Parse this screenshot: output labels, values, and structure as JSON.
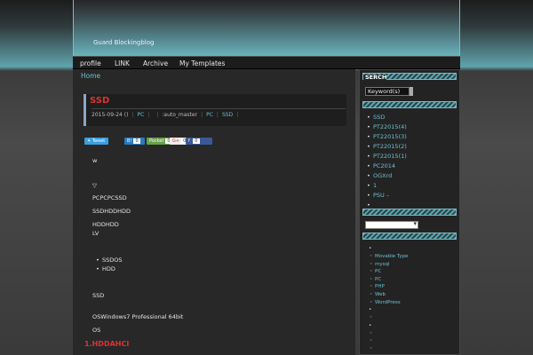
{
  "site": {
    "title": "Guard Blockingblog"
  },
  "nav": {
    "items": [
      "profile",
      "LINK",
      "Archive",
      "My Templates"
    ]
  },
  "breadcrumb": {
    "home": "Home"
  },
  "post": {
    "title": "SSD",
    "date": "2015-09-24 ()",
    "category": "PC",
    "author": ":auto_master",
    "tags": [
      "PC",
      "SSD"
    ],
    "body": [
      "w",
      "▽",
      "PCPCPCSSD",
      "SSDHDDHDD",
      "HDDHDD",
      "LV",
      "SSD",
      "OSWindows7 Professional 64bit",
      "OS"
    ],
    "bullets": [
      "SSDOS",
      "HDD"
    ],
    "subheading": "1.HDDAHCI"
  },
  "social": {
    "tweet": "Tweet",
    "hatena_count": "0",
    "pocket": "Pocket",
    "pocket_count": "0",
    "gplus": "G+",
    "gplus_count": "0",
    "fb_count": "0"
  },
  "sidebar": {
    "search_title": "SERCH",
    "search_placeholder": "Keyword(s)",
    "recent": [
      "SSD",
      "PT22015(4)",
      "PT22015(3)",
      "PT22015(2)",
      "PT22015(1)",
      "PC2014",
      "OGXrd",
      "1",
      "PSU –"
    ],
    "categories": [
      "Movable Type",
      "mysql",
      "PC",
      "PC",
      "PHP",
      "Web",
      "WordPress"
    ]
  },
  "colors": {
    "accent": "#6cc0d0",
    "title_red": "#dd3333"
  }
}
